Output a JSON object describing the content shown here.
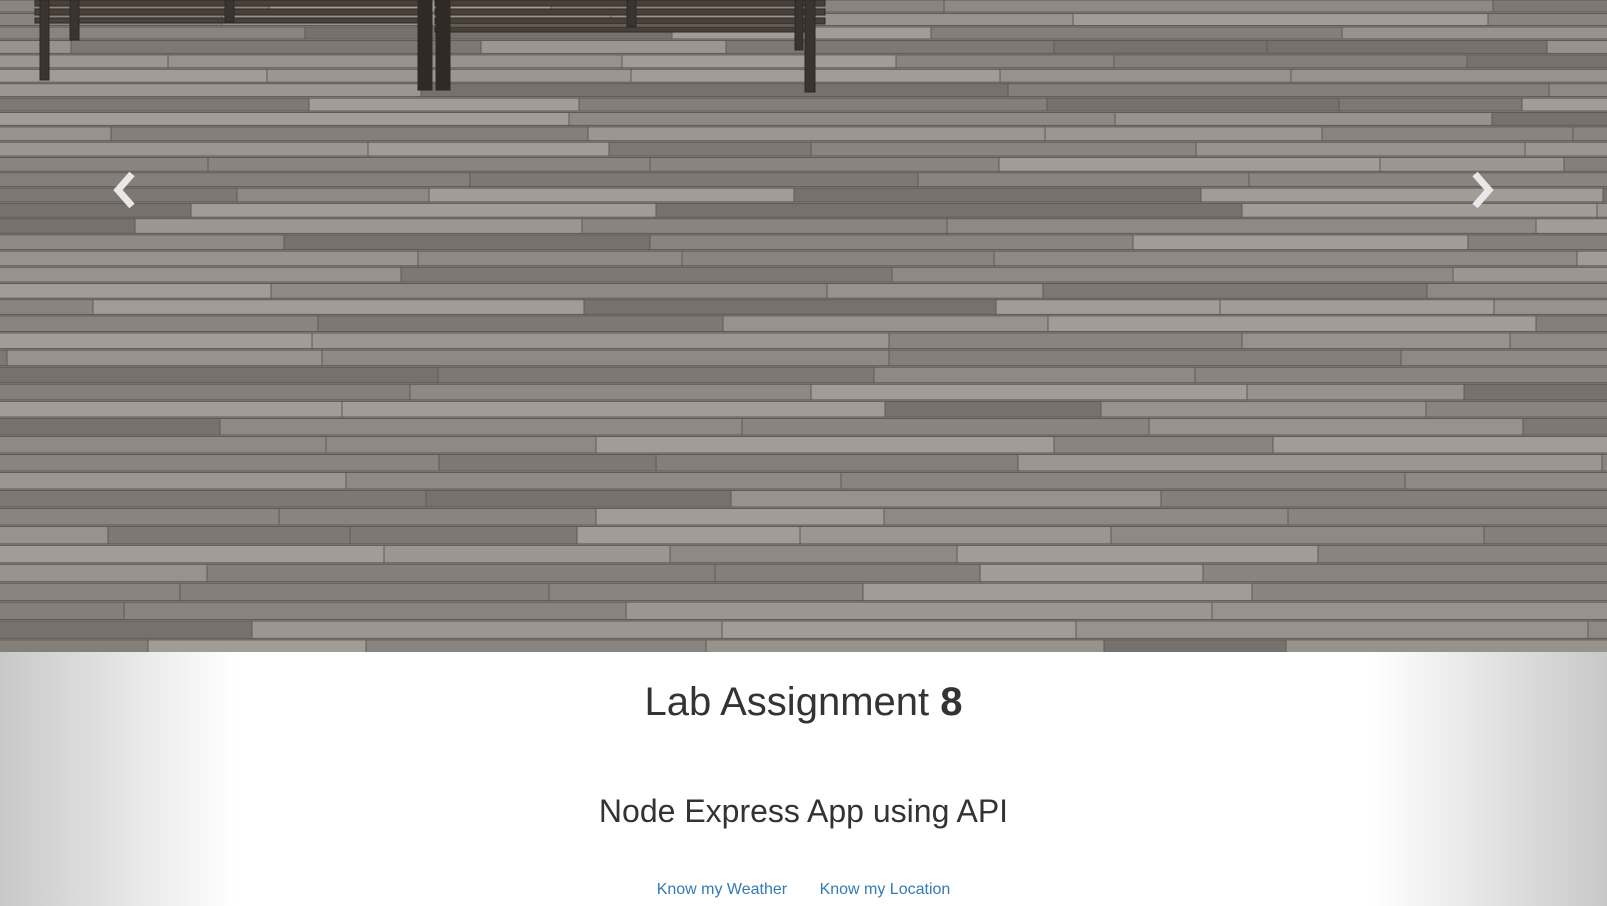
{
  "carousel": {
    "image": "wooden-boardwalk-deck-with-benches",
    "prev_icon": "chevron-left-icon",
    "next_icon": "chevron-right-icon"
  },
  "header": {
    "title_text": "Lab Assignment",
    "title_number": "8",
    "subtitle": "Node Express App using API"
  },
  "nav": {
    "links": [
      {
        "label": "Know my Weather"
      },
      {
        "label": "Know my Location"
      }
    ]
  },
  "colors": {
    "link": "#337ab7",
    "text": "#333333"
  }
}
